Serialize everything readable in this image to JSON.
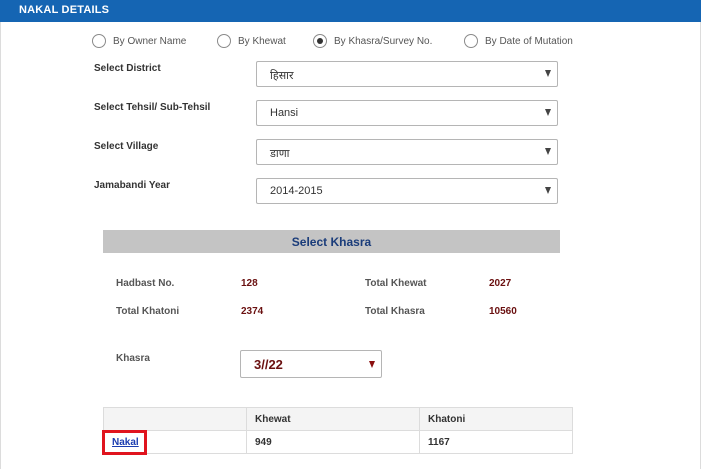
{
  "header": {
    "title": "NAKAL DETAILS"
  },
  "search_mode": {
    "options": [
      {
        "label": "By Owner Name",
        "checked": false
      },
      {
        "label": "By Khewat",
        "checked": false
      },
      {
        "label": "By Khasra/Survey No.",
        "checked": true
      },
      {
        "label": "By Date of Mutation",
        "checked": false
      }
    ]
  },
  "form": {
    "district": {
      "label": "Select District",
      "value": "हिसार"
    },
    "tehsil": {
      "label": "Select Tehsil/ Sub-Tehsil",
      "value": "Hansi"
    },
    "village": {
      "label": "Select Village",
      "value": "डाणा"
    },
    "year": {
      "label": "Jamabandi Year",
      "value": "2014-2015"
    }
  },
  "khasra_panel": {
    "title": "Select Khasra",
    "hadbast_label": "Hadbast No.",
    "hadbast_value": "128",
    "total_khewat_label": "Total Khewat",
    "total_khewat_value": "2027",
    "total_khatoni_label": "Total Khatoni",
    "total_khatoni_value": "2374",
    "total_khasra_label": "Total Khasra",
    "total_khasra_value": "10560",
    "khasra_label": "Khasra",
    "khasra_value": "3//22"
  },
  "results_table": {
    "headers": [
      "",
      "Khewat",
      "Khatoni"
    ],
    "rows": [
      {
        "link": "Nakal",
        "khewat": "949",
        "khatoni": "1167"
      }
    ]
  },
  "colors": {
    "header_bg": "#1565b3",
    "panel_title": "#1a3c7a",
    "value_text": "#6a1010",
    "link": "#1a3cb0",
    "highlight": "#e0141e"
  }
}
